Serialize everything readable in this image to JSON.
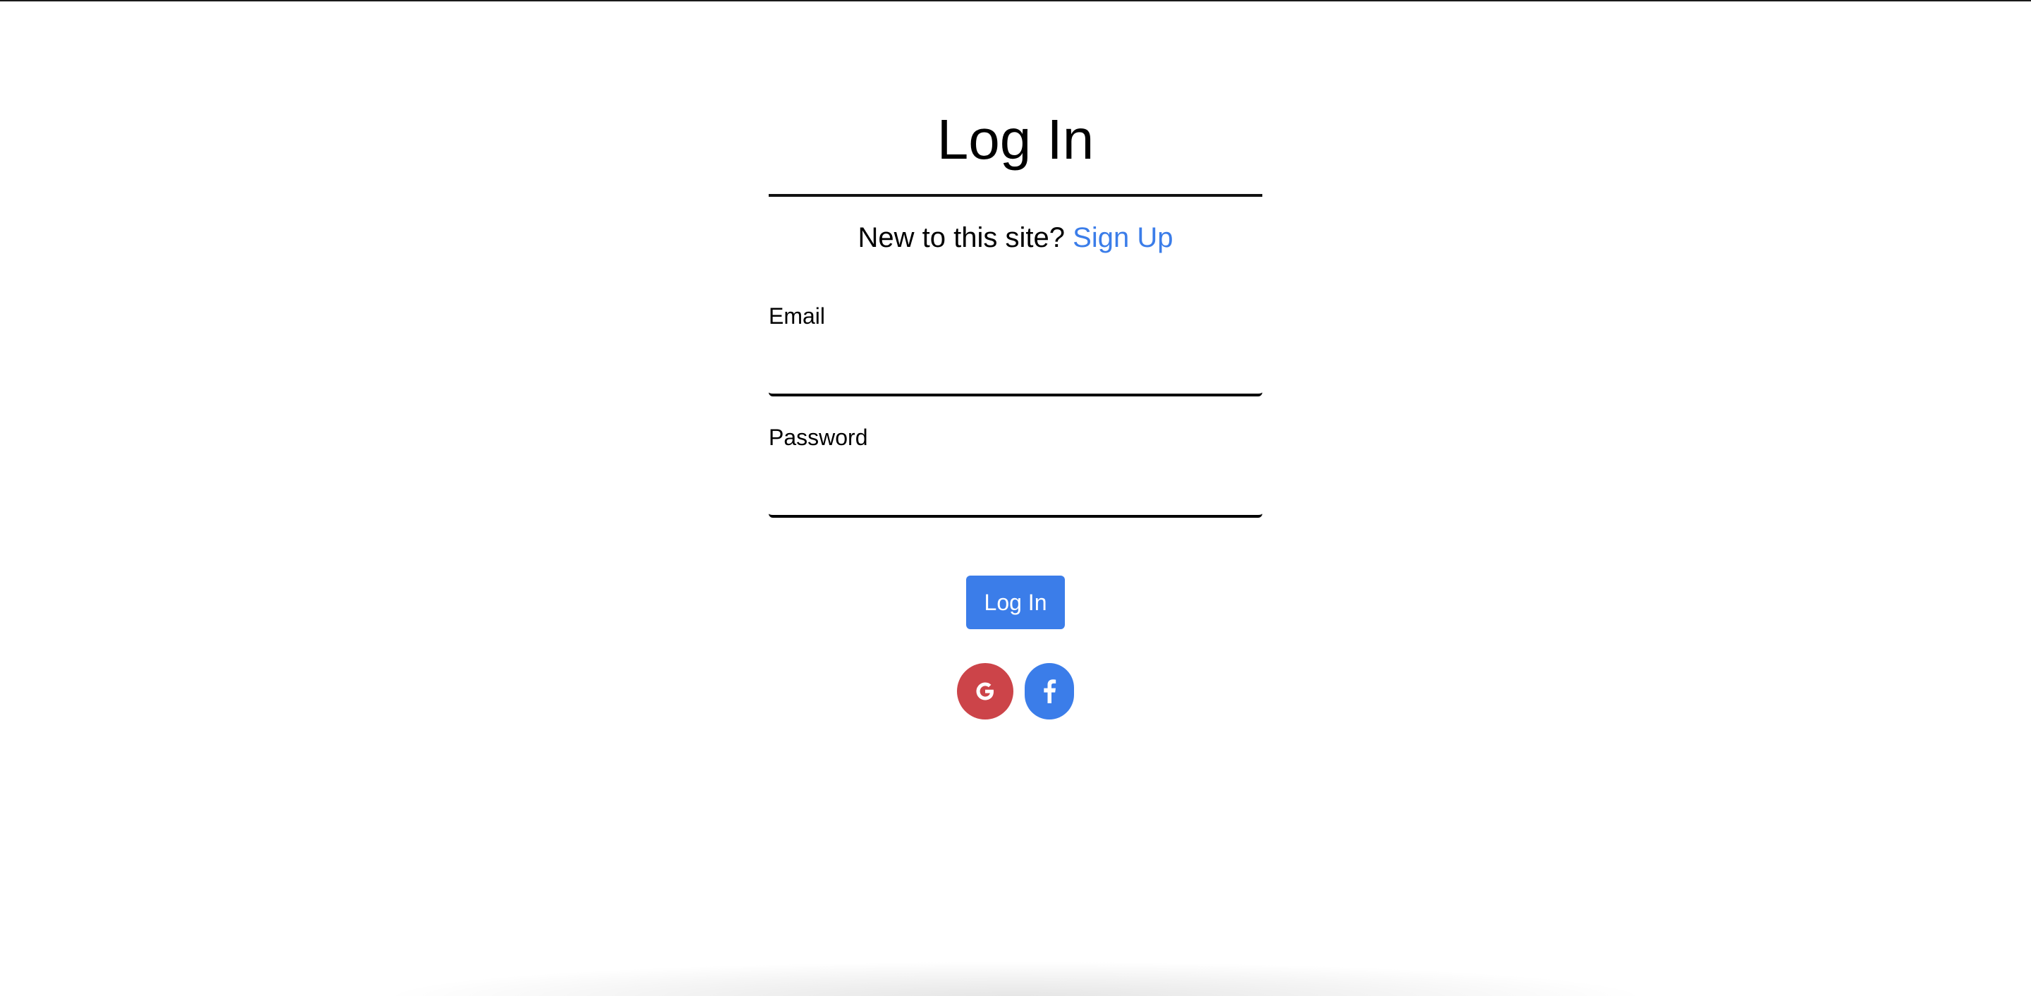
{
  "login": {
    "title": "Log In",
    "signup_prompt": "New to this site?",
    "signup_link": "Sign Up",
    "email_label": "Email",
    "email_value": "",
    "password_label": "Password",
    "password_value": "",
    "submit_label": "Log In",
    "social": [
      {
        "name": "google",
        "icon": "google-icon",
        "color": "#cc4449"
      },
      {
        "name": "facebook",
        "icon": "facebook-icon",
        "color": "#3b7de9"
      }
    ]
  },
  "colors": {
    "accent": "#3b7de9",
    "google": "#cc4449",
    "text": "#000000",
    "background": "#ffffff"
  }
}
